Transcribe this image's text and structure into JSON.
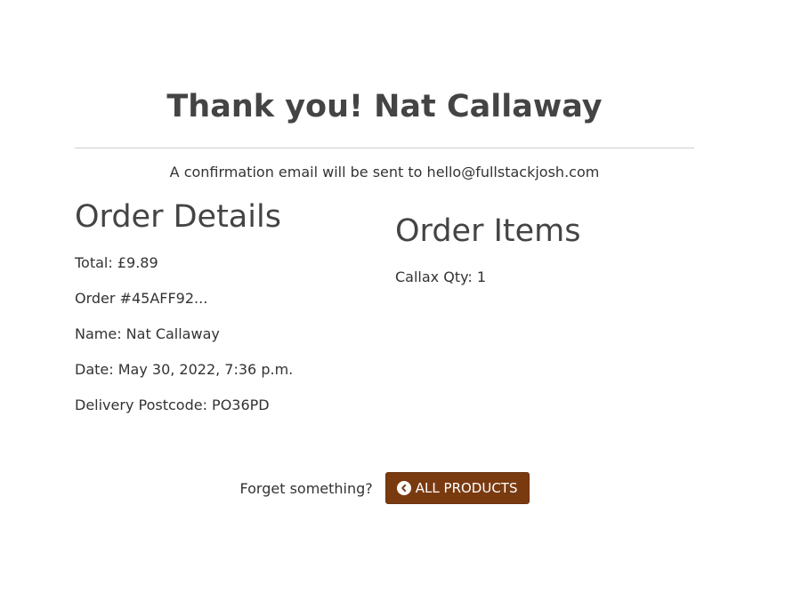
{
  "heading": "Thank you! Nat Callaway",
  "confirmation_text": "A confirmation email will be sent to hello@fullstackjosh.com",
  "order_details": {
    "title": "Order Details",
    "total": "Total: £9.89",
    "order_number": "Order #45AFF92...",
    "name": "Name: Nat Callaway",
    "date": "Date: May 30, 2022, 7:36 p.m.",
    "postcode": "Delivery Postcode: PO36PD"
  },
  "order_items": {
    "title": "Order Items",
    "items": [
      "Callax Qty: 1"
    ]
  },
  "footer": {
    "prompt": "Forget something?",
    "button_label": "ALL PRODUCTS",
    "button_icon": "chevron-circle-left-icon"
  },
  "colors": {
    "button_bg": "#7a3a10",
    "text": "#333333",
    "heading": "#444444"
  }
}
